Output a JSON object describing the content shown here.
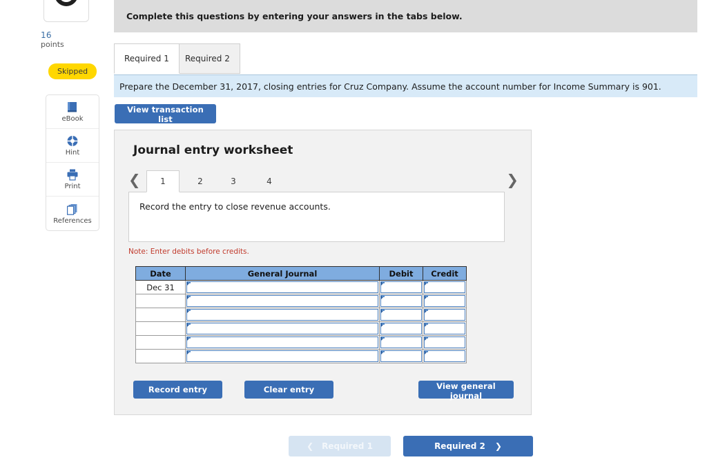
{
  "sidebar": {
    "score_icon": "progress-ring-icon",
    "points_value": "16",
    "points_label": "points",
    "status_badge": "Skipped",
    "status_badge_color": "#ffd700",
    "tools": [
      {
        "label": "eBook",
        "icon": "book-icon"
      },
      {
        "label": "Hint",
        "icon": "lifebuoy-icon"
      },
      {
        "label": "Print",
        "icon": "printer-icon"
      },
      {
        "label": "References",
        "icon": "copy-pages-icon"
      }
    ]
  },
  "header": {
    "instruction": "Complete this questions by entering your answers in the tabs below."
  },
  "required_tabs": [
    {
      "label": "Required 1",
      "active": true
    },
    {
      "label": "Required 2",
      "active": false
    }
  ],
  "prompt": {
    "text": "Prepare the December 31, 2017, closing entries for Cruz Company. Assume the account number for Income Summary is 901."
  },
  "toolbar": {
    "view_transaction_list": "View transaction list"
  },
  "worksheet": {
    "title": "Journal entry worksheet",
    "prev_icon": "chevron-left-icon",
    "next_icon": "chevron-right-icon",
    "steps": [
      {
        "label": "1",
        "active": true
      },
      {
        "label": "2",
        "active": false
      },
      {
        "label": "3",
        "active": false
      },
      {
        "label": "4",
        "active": false
      }
    ],
    "entry_instruction": "Record the entry to close revenue accounts.",
    "note": "Note: Enter debits before credits.",
    "table": {
      "headers": [
        "Date",
        "General Journal",
        "Debit",
        "Credit"
      ],
      "header_color": "#7facdf",
      "rows": [
        {
          "date": "Dec 31",
          "general_journal": "",
          "debit": "",
          "credit": ""
        },
        {
          "date": "",
          "general_journal": "",
          "debit": "",
          "credit": ""
        },
        {
          "date": "",
          "general_journal": "",
          "debit": "",
          "credit": ""
        },
        {
          "date": "",
          "general_journal": "",
          "debit": "",
          "credit": ""
        },
        {
          "date": "",
          "general_journal": "",
          "debit": "",
          "credit": ""
        },
        {
          "date": "",
          "general_journal": "",
          "debit": "",
          "credit": ""
        }
      ]
    },
    "buttons": {
      "record": "Record entry",
      "clear": "Clear entry",
      "view_journal": "View general journal"
    }
  },
  "footer": {
    "prev_label": "Required 1",
    "prev_icon": "chevron-left-icon",
    "prev_disabled": true,
    "next_label": "Required 2",
    "next_icon": "chevron-right-icon",
    "accent_color": "#3a6eb5"
  }
}
